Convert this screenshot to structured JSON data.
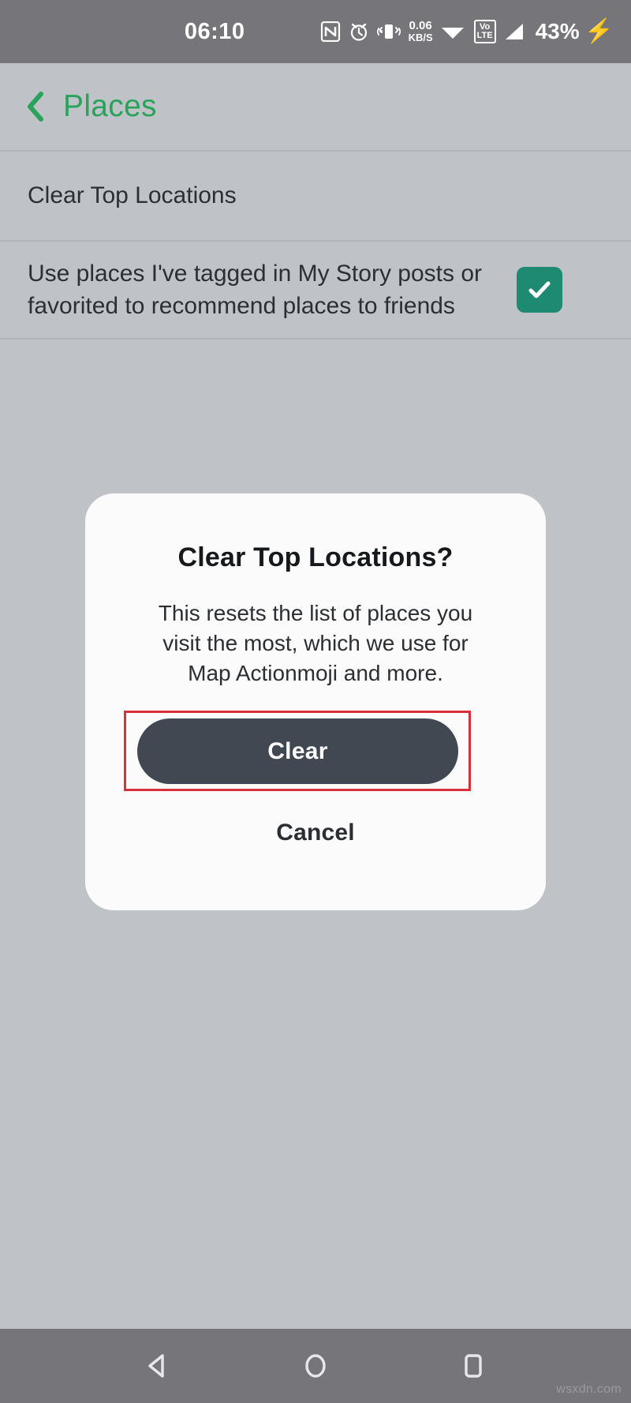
{
  "status_bar": {
    "clock": "06:10",
    "data_rate_value": "0.06",
    "data_rate_unit": "KB/S",
    "volte_top": "Vo",
    "volte_bottom": "LTE",
    "battery_percent": "43%",
    "charging_glyph": "⚡",
    "icons": [
      "nfc-icon",
      "alarm-icon",
      "vibrate-icon",
      "data-rate-indicator",
      "wifi-icon",
      "volte-icon",
      "cellular-signal-icon",
      "battery-percent",
      "charging-bolt-icon"
    ],
    "background": "#76767a"
  },
  "header": {
    "back_label": "‹",
    "title": "Places",
    "accent_color": "#29a35a"
  },
  "settings": {
    "rows": [
      {
        "label": "Clear Top Locations",
        "type": "action"
      },
      {
        "label": "Use places I've tagged in My Story posts or favorited to recommend places to friends",
        "type": "checkbox",
        "checked": true
      }
    ],
    "checkbox_color": "#1f8a72"
  },
  "dialog": {
    "title": "Clear Top Locations?",
    "body": "This resets the list of places you visit the most, which we use for Map Actionmoji and more.",
    "primary_button": "Clear",
    "secondary_button": "Cancel",
    "primary_color": "#414852",
    "surface_color": "#fbfbfb",
    "highlight_color": "#d8313c",
    "highlight_target": "Clear"
  },
  "nav_bar": {
    "buttons": [
      "back-nav-button",
      "home-nav-button",
      "recents-nav-button"
    ],
    "background": "#76767a"
  },
  "watermark": "wsxdn.com"
}
